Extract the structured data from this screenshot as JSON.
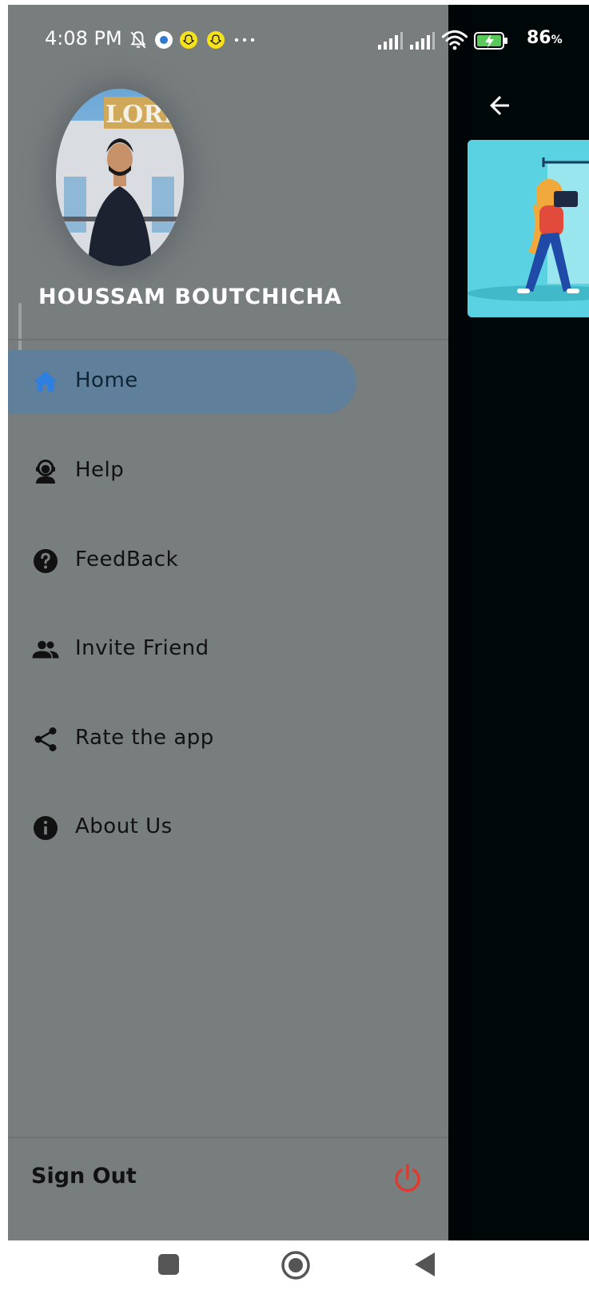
{
  "status_bar": {
    "time": "4:08 PM",
    "battery_percent": "86",
    "battery_suffix": "%",
    "icons": [
      "mute-bell-icon",
      "app-notification-icon",
      "snapchat-icon",
      "snapchat-icon",
      "more-dots-icon",
      "signal-icon",
      "signal-icon",
      "wifi-icon",
      "battery-charging-icon"
    ]
  },
  "drawer": {
    "user_name": "HOUSSAM BOUTCHICHA",
    "menu": [
      {
        "id": "home",
        "label": "Home",
        "icon": "home-icon",
        "selected": true
      },
      {
        "id": "help",
        "label": "Help",
        "icon": "support-agent-icon",
        "selected": false
      },
      {
        "id": "feedback",
        "label": "FeedBack",
        "icon": "question-circle-icon",
        "selected": false
      },
      {
        "id": "invite",
        "label": "Invite Friend",
        "icon": "people-icon",
        "selected": false
      },
      {
        "id": "rate",
        "label": "Rate the app",
        "icon": "share-icon",
        "selected": false
      },
      {
        "id": "about",
        "label": "About Us",
        "icon": "info-icon",
        "selected": false
      }
    ],
    "sign_out_label": "Sign Out"
  },
  "colors": {
    "drawer_bg": "#787d7e",
    "selected_bg": "#5f7f9a",
    "home_icon": "#2f7fe0",
    "power_icon": "#e03a2e",
    "app_bg": "#000708",
    "card_bg": "#5ad2e2"
  },
  "nav_bar": {
    "buttons": [
      "recents-square-icon",
      "home-circle-icon",
      "back-triangle-icon"
    ]
  }
}
